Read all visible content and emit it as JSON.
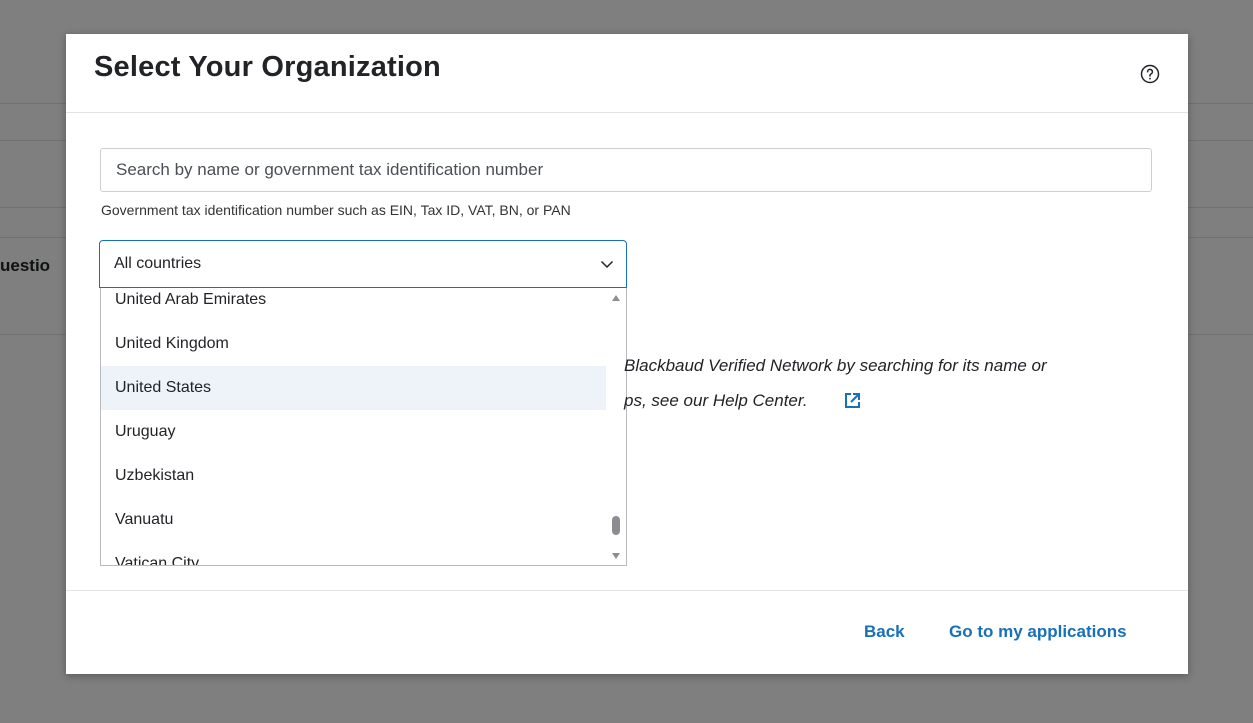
{
  "background": {
    "partial_label": "uestio"
  },
  "modal": {
    "title": "Select Your Organization",
    "help_icon": "question-circle-icon",
    "search": {
      "placeholder": "Search by name or government tax identification number",
      "value": "",
      "hint": "Government tax identification number such as EIN, Tax ID, VAT, BN, or PAN"
    },
    "country_select": {
      "selected": "All countries",
      "icon": "chevron-down-icon",
      "options": [
        {
          "label": "United Arab Emirates",
          "highlighted": false
        },
        {
          "label": "United Kingdom",
          "highlighted": false
        },
        {
          "label": "United States",
          "highlighted": true
        },
        {
          "label": "Uruguay",
          "highlighted": false
        },
        {
          "label": "Uzbekistan",
          "highlighted": false
        },
        {
          "label": "Vanuatu",
          "highlighted": false
        },
        {
          "label": "Vatican City",
          "highlighted": false
        }
      ]
    },
    "info": {
      "line1": "Blackbaud Verified Network by searching for its name or",
      "line2": "ps, see our Help Center.",
      "link_icon": "external-link-icon"
    },
    "footer": {
      "back_label": "Back",
      "applications_label": "Go to my applications"
    }
  },
  "colors": {
    "accent": "#1870b8",
    "text": "#212327",
    "highlight": "#eef3f9",
    "overlay": "rgba(0,0,0,0.5)"
  }
}
